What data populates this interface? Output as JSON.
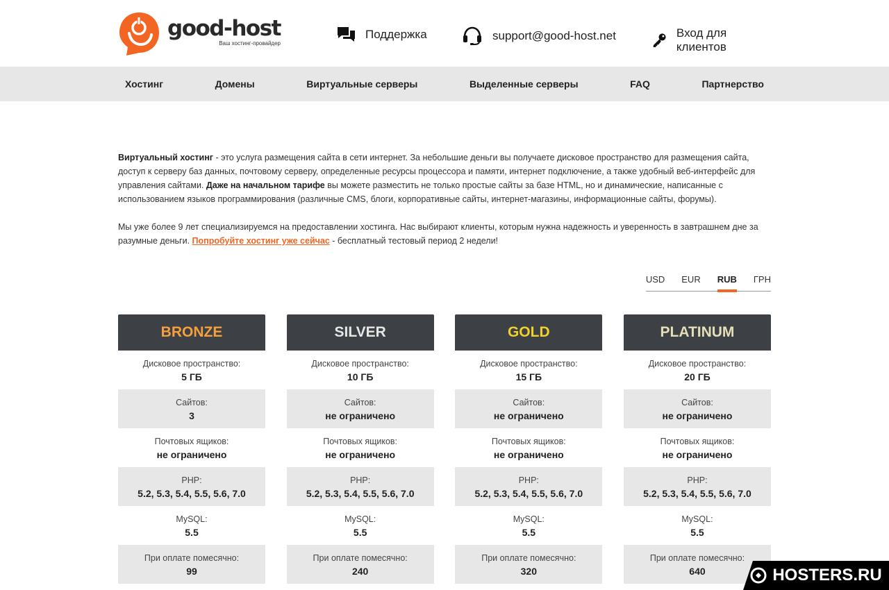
{
  "brand": {
    "name": "good-host",
    "tagline": "Ваш хостинг-провайдер",
    "accent": "#f26522"
  },
  "header": {
    "support_label": "Поддержка",
    "email": "support@good-host.net",
    "login_label": "Вход для клиентов"
  },
  "nav": {
    "items": [
      "Хостинг",
      "Домены",
      "Виртуальные серверы",
      "Выделенные серверы",
      "FAQ",
      "Партнерство"
    ]
  },
  "intro": {
    "p1_bold1": "Виртуальный хостинг",
    "p1_text1": " - это услуга размещения сайта в сети интернет. За небольшие деньги вы получаете дисковое пространство для размещения сайта, доступ к серверу баз данных, почтовому серверу, определенные ресурсы процессора и памяти, интернет подключение, а также удобный веб-интерфейс для управления сайтами. ",
    "p1_bold2": "Даже на начальном тарифе",
    "p1_text2": " вы можете разместить не только простые сайты за базе HTML, но и динамические, написанные с использованием языков программирования (различные CMS, блоги, корпоративные сайты, интернет-магазины, информационные сайты, форумы).",
    "p2_text1": "Мы уже более 9 лет специализируемся на предоставлении хостинга. Нас выбирают клиенты, которым нужна надежность и уверенность в завтрашнем дне за разумные деньги. ",
    "p2_link": "Попробуйте хостинг уже сейчас",
    "p2_text2": " - бесплатный тестовый период 2 недели!"
  },
  "currency": {
    "options": [
      "USD",
      "EUR",
      "RUB",
      "ГРН"
    ],
    "selected": "RUB"
  },
  "labels": {
    "disk": "Дисковое пространство:",
    "sites": "Сайтов:",
    "mail": "Почтовых ящиков:",
    "php": "PHP:",
    "mysql": "MySQL:",
    "monthly": "При оплате помесячно:"
  },
  "plans": [
    {
      "name": "BRONZE",
      "color": "#f5a03c",
      "disk": "5 ГБ",
      "sites": "3",
      "mail": "не ограничено",
      "php": "5.2, 5.3, 5.4, 5.5, 5.6, 7.0",
      "mysql": "5.5",
      "monthly": "99"
    },
    {
      "name": "SILVER",
      "color": "#e6e6e6",
      "disk": "10 ГБ",
      "sites": "не ограничено",
      "mail": "не ограничено",
      "php": "5.2, 5.3, 5.4, 5.5, 5.6, 7.0",
      "mysql": "5.5",
      "monthly": "240"
    },
    {
      "name": "GOLD",
      "color": "#f2d12a",
      "disk": "15 ГБ",
      "sites": "не ограничено",
      "mail": "не ограничено",
      "php": "5.2, 5.3, 5.4, 5.5, 5.6, 7.0",
      "mysql": "5.5",
      "monthly": "320"
    },
    {
      "name": "PLATINUM",
      "color": "#e4dfb8",
      "disk": "20 ГБ",
      "sites": "не ограничено",
      "mail": "не ограничено",
      "php": "5.2, 5.3, 5.4, 5.5, 5.6, 7.0",
      "mysql": "5.5",
      "monthly": "640"
    }
  ],
  "watermark": "HOSTERS.RU"
}
